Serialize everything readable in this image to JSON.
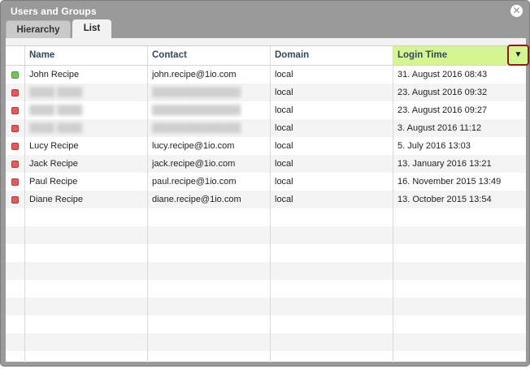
{
  "window": {
    "title": "Users and Groups",
    "close_glyph": "✕"
  },
  "tabs": [
    {
      "label": "Hierarchy"
    },
    {
      "label": "List"
    }
  ],
  "columns": {
    "name": "Name",
    "contact": "Contact",
    "domain": "Domain",
    "login": "Login Time",
    "sort_glyph": "▼"
  },
  "colors": {
    "status_active": "#79c262",
    "status_inactive": "#e05d5d",
    "login_header_highlight": "#d4f58f",
    "sort_button_outline": "#8b1a1a"
  },
  "rows": [
    {
      "status": "active",
      "name": "John Recipe",
      "contact": "john.recipe@1io.com",
      "domain": "local",
      "login": "31. August 2016 08:43",
      "redacted": false
    },
    {
      "status": "inactive",
      "name": "",
      "contact": "",
      "domain": "local",
      "login": "23. August 2016 09:32",
      "redacted": true
    },
    {
      "status": "inactive",
      "name": "",
      "contact": "",
      "domain": "local",
      "login": "23. August 2016 09:27",
      "redacted": true
    },
    {
      "status": "inactive",
      "name": "",
      "contact": "",
      "domain": "local",
      "login": "3. August 2016 11:12",
      "redacted": true
    },
    {
      "status": "inactive",
      "name": "Lucy Recipe",
      "contact": "lucy.recipe@1io.com",
      "domain": "local",
      "login": "5. July 2016 13:03",
      "redacted": false
    },
    {
      "status": "inactive",
      "name": "Jack Recipe",
      "contact": "jack.recipe@1io.com",
      "domain": "local",
      "login": "13. January 2016 13:21",
      "redacted": false
    },
    {
      "status": "inactive",
      "name": "Paul Recipe",
      "contact": "paul.recipe@1io.com",
      "domain": "local",
      "login": "16. November 2015 13:49",
      "redacted": false
    },
    {
      "status": "inactive",
      "name": "Diane Recipe",
      "contact": "diane.recipe@1io.com",
      "domain": "local",
      "login": "13. October 2015 13:54",
      "redacted": false
    }
  ]
}
